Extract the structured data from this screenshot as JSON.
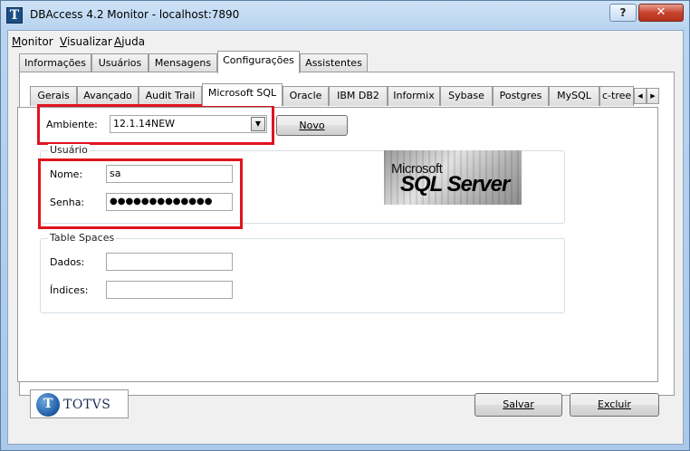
{
  "window": {
    "title": "DBAccess 4.2 Monitor - localhost:7890",
    "help_label": "?",
    "close_label": "✕"
  },
  "menu": {
    "items": [
      {
        "label": "Monitor",
        "accel": "M",
        "rest": "onitor"
      },
      {
        "label": "Visualizar",
        "accel": "V",
        "rest": "isualizar"
      },
      {
        "label": "Ajuda",
        "accel": "A",
        "rest": "juda"
      }
    ]
  },
  "outer_tabs": [
    {
      "label": "Informações",
      "active": false
    },
    {
      "label": "Usuários",
      "active": false
    },
    {
      "label": "Mensagens",
      "active": false
    },
    {
      "label": "Configurações",
      "active": true
    },
    {
      "label": "Assistentes",
      "active": false
    }
  ],
  "inner_tabs": [
    {
      "label": "Gerais",
      "active": false
    },
    {
      "label": "Avançado",
      "active": false
    },
    {
      "label": "Audit Trail",
      "active": false
    },
    {
      "label": "Microsoft SQL",
      "active": true
    },
    {
      "label": "Oracle",
      "active": false
    },
    {
      "label": "IBM DB2",
      "active": false
    },
    {
      "label": "Informix",
      "active": false
    },
    {
      "label": "Sybase",
      "active": false
    },
    {
      "label": "Postgres",
      "active": false
    },
    {
      "label": "MySQL",
      "active": false
    },
    {
      "label": "c-tree",
      "active": false
    }
  ],
  "ambiente": {
    "label": "Ambiente:",
    "value": "12.1.14NEW",
    "novo_label": "Novo"
  },
  "usuario": {
    "group_title": "Usuário",
    "nome_label": "Nome:",
    "nome_value": "sa",
    "senha_label": "Senha:",
    "senha_value": "●●●●●●●●●●●●●"
  },
  "logo": {
    "line1": "Microsoft",
    "line2": "SQL Server"
  },
  "table_spaces": {
    "group_title": "Table Spaces",
    "dados_label": "Dados:",
    "dados_value": "",
    "indices_label": "Índices:",
    "indices_value": ""
  },
  "footer": {
    "brand": "TOTVS",
    "salvar_label": "Salvar",
    "excluir_label": "Excluir"
  },
  "colors": {
    "highlight": "#e0141e",
    "close_button": "#c7432e"
  }
}
